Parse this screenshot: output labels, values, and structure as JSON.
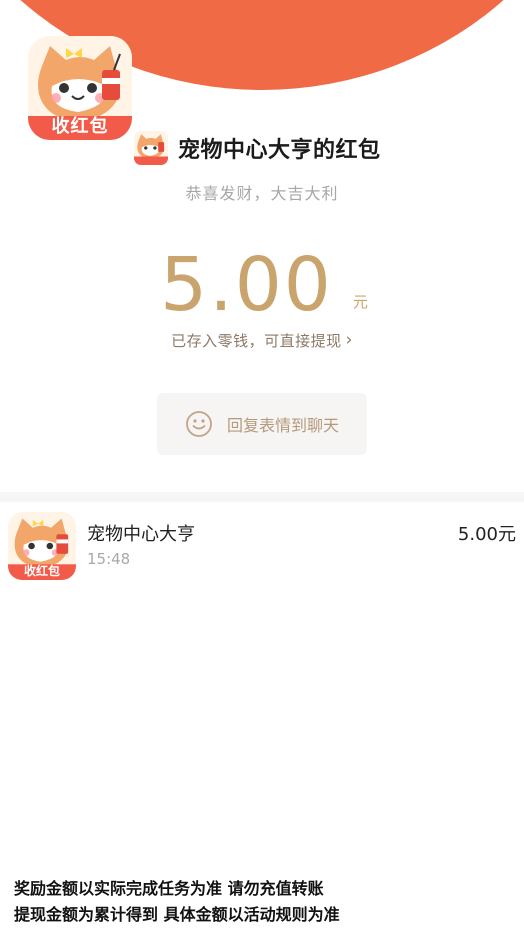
{
  "nav": {
    "back_icon": "chevron-left-icon",
    "menu_icon": "list-menu-icon"
  },
  "app_icon": {
    "badge_text": "收红包",
    "icon": "cat-drinking-icon"
  },
  "sender": {
    "title": "宠物中心大亨的红包"
  },
  "greeting": "恭喜发财，大吉大利",
  "amount": {
    "value": "5.00",
    "unit": "元"
  },
  "stored_link": {
    "label": "已存入零钱，可直接提现",
    "chevron": "›"
  },
  "reply_button": {
    "label": "回复表情到聊天",
    "icon": "smile-icon"
  },
  "record": {
    "name": "宠物中心大亨",
    "time": "15:48",
    "amount": "5.00元"
  },
  "footer": {
    "line1": "奖励金额以实际完成任务为准  请勿充值转账",
    "line2": "提现金额为累计得到    具体金额以活动规则为准"
  },
  "colors": {
    "header": "#f06a45",
    "gold": "#c9a46c",
    "badge": "#f25a4a"
  }
}
